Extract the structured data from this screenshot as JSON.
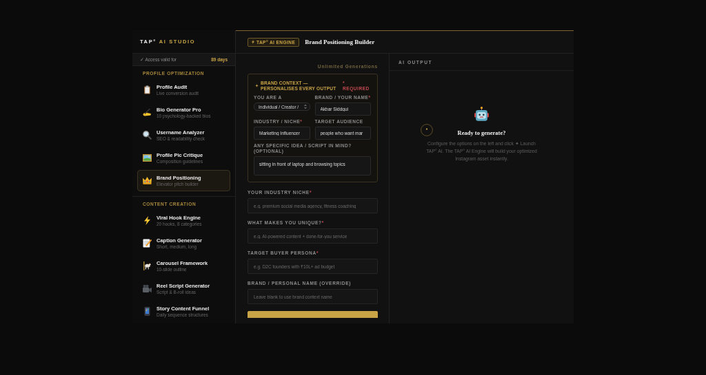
{
  "sidebar": {
    "brand": {
      "name": "TAP°",
      "suffix": "AI STUDIO"
    },
    "access": {
      "label": "✓ Access valid for",
      "days": "89 days"
    },
    "sections": [
      {
        "title": "PROFILE OPTIMIZATION",
        "items": [
          {
            "title": "Profile Audit",
            "subtitle": "Live conversion audit",
            "selected": false
          },
          {
            "title": "Bio Generator Pro",
            "subtitle": "10 psychology-backed bios",
            "selected": false
          },
          {
            "title": "Username Analyzer",
            "subtitle": "SEO & readability check",
            "selected": false
          },
          {
            "title": "Profile Pic Critique",
            "subtitle": "Composition guidelines",
            "selected": false
          },
          {
            "title": "Brand Positioning",
            "subtitle": "Elevator pitch builder",
            "selected": true
          }
        ]
      },
      {
        "title": "CONTENT CREATION",
        "items": [
          {
            "title": "Viral Hook Engine",
            "subtitle": "20 hooks, 8 categories",
            "selected": false
          },
          {
            "title": "Caption Generator",
            "subtitle": "Short, medium, long",
            "selected": false
          },
          {
            "title": "Carousel Framework",
            "subtitle": "10-slide outline",
            "selected": false
          },
          {
            "title": "Reel Script Generator",
            "subtitle": "Script & B-roll ideas",
            "selected": false
          },
          {
            "title": "Story Content Funnel",
            "subtitle": "Daily sequence structures",
            "selected": false
          }
        ]
      }
    ]
  },
  "header": {
    "badge": "TAP° AI ENGINE",
    "title": "Brand Positioning Builder"
  },
  "form": {
    "generations": "Unlimited Generations",
    "context_card": {
      "title": "BRAND CONTEXT — PERSONALISES EVERY OUTPUT",
      "required": "* REQUIRED",
      "fields": [
        {
          "kind": "select",
          "label": "YOU ARE A",
          "value": "Individual / Creator /"
        },
        {
          "kind": "input",
          "label": "BRAND / YOUR NAME",
          "required_mark": "*",
          "value": "Akbar Siddqui"
        },
        {
          "kind": "input",
          "label": "INDUSTRY / NICHE",
          "required_mark": "*",
          "value": "Marketing Influencer"
        },
        {
          "kind": "input",
          "label": "TARGET AUDIENCE",
          "value": "people who want mar"
        },
        {
          "kind": "textarea",
          "label": "ANY SPECIFIC IDEA / SCRIPT IN MIND? (OPTIONAL)",
          "value": "sitting in front of laptop and browsing topics"
        }
      ]
    },
    "fields": [
      {
        "label": "YOUR INDUSTRY NICHE",
        "required_mark": "*",
        "placeholder": "e.g. premium social media agency, fitness coaching"
      },
      {
        "label": "WHAT MAKES YOU UNIQUE?",
        "required_mark": "*",
        "placeholder": "e.g. AI-powered content + done-for-you service"
      },
      {
        "label": "TARGET BUYER PERSONA",
        "required_mark": "*",
        "placeholder": "e.g. D2C founders with ₹10L+ ad budget"
      },
      {
        "label": "BRAND / PERSONAL NAME (OVERRIDE)",
        "placeholder": "Leave blank to use brand context name"
      }
    ]
  },
  "output": {
    "title": "AI OUTPUT",
    "heading": "Ready to generate?",
    "text": "Configure the options on the left and click ✦ Launch TAP° AI. The TAP° AI Engine will build your optimized Instagram asset instantly."
  }
}
